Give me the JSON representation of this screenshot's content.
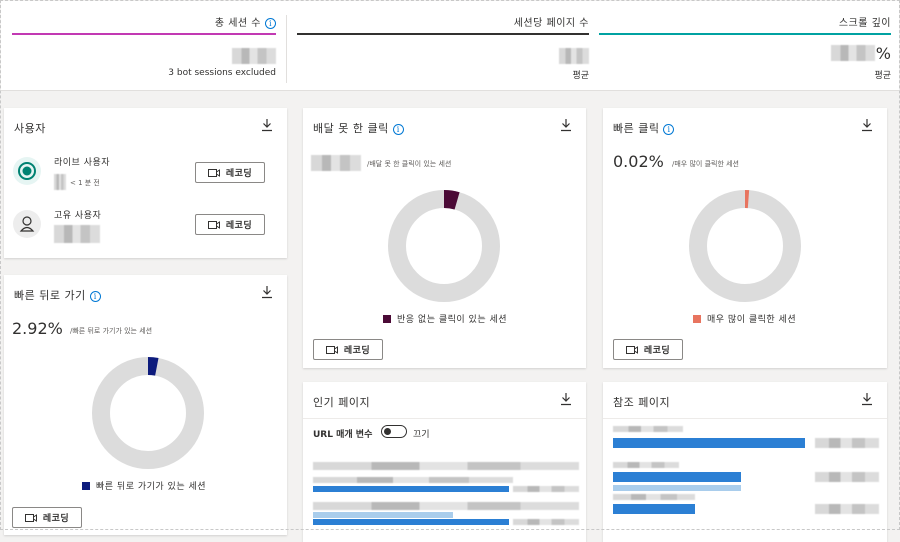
{
  "metrics": {
    "total_sessions": {
      "title": "총 세션 수",
      "sub": "3 bot sessions excluded",
      "accent": "#c239b3"
    },
    "pages_per_session": {
      "title": "세션당 페이지 수",
      "sub": "평균",
      "accent": "#323130"
    },
    "scroll_depth": {
      "title": "스크롤 깊이",
      "unit": "%",
      "sub": "평균",
      "accent": "#00a2a2"
    }
  },
  "users_card": {
    "title": "사용자",
    "live_label": "라이브 사용자",
    "live_sub": "< 1 분 전",
    "unique_label": "고유 사용자",
    "record_label": "레코딩"
  },
  "dead_clicks": {
    "title": "배달 못 한 클릭",
    "pct_label": "/배달 못 한 클릭이 있는 세션",
    "legend": "반응 없는 클릭이 있는 세션",
    "color": "#4b0a36",
    "fraction": 0.045,
    "record_label": "레코딩"
  },
  "rage_clicks": {
    "title": "빠른 클릭",
    "pct": "0.02%",
    "pct_label": "/매우 많이 클릭한 세션",
    "legend": "매우 많이 클릭한 세션",
    "color": "#e8745f",
    "fraction": 0.012,
    "record_label": "레코딩"
  },
  "quick_backs": {
    "title": "빠른 뒤로 가기",
    "pct": "2.92%",
    "pct_label": "/빠른 뒤로 가기가 있는 세션",
    "legend": "빠른 뒤로 가기가 있는 세션",
    "color": "#0d1b7d",
    "fraction": 0.03,
    "record_label": "레코딩"
  },
  "popular_pages": {
    "title": "인기 페이지",
    "url_param_label": "URL 매개 변수",
    "toggle_state": "끄기"
  },
  "referrers": {
    "title": "참조 페이지"
  },
  "colors": {
    "bar_dark": "#2b7fd4",
    "bar_light": "#a9cdec",
    "donut_track": "#dcdcdc"
  }
}
